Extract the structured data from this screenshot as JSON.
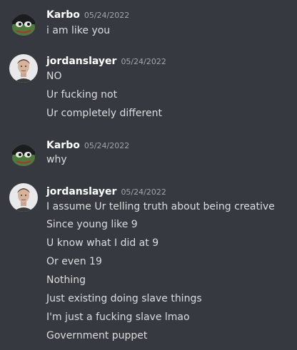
{
  "messages": [
    {
      "author": "Karbo",
      "avatar_icon": "frog-avatar-icon",
      "timestamp": "05/24/2022",
      "lines": [
        "i am like you"
      ]
    },
    {
      "author": "jordanslayer",
      "avatar_icon": "man-avatar-icon",
      "timestamp": "05/24/2022",
      "lines": [
        "NO",
        "Ur fucking not",
        "Ur completely different"
      ]
    },
    {
      "author": "Karbo",
      "avatar_icon": "frog-avatar-icon",
      "timestamp": "05/24/2022",
      "lines": [
        "why"
      ]
    },
    {
      "author": "jordanslayer",
      "avatar_icon": "man-avatar-icon",
      "timestamp": "05/24/2022",
      "lines": [
        "I assume Ur telling truth about being creative",
        "Since young like 9",
        "U know what I did at 9",
        "Or even 19",
        "Nothing",
        "Just existing doing slave things",
        "I'm just a fucking slave lmao",
        "Government puppet"
      ]
    }
  ],
  "colors": {
    "background": "#36393f",
    "username": "#ffffff",
    "timestamp": "#a3a6aa",
    "message_text": "#dcddde"
  }
}
